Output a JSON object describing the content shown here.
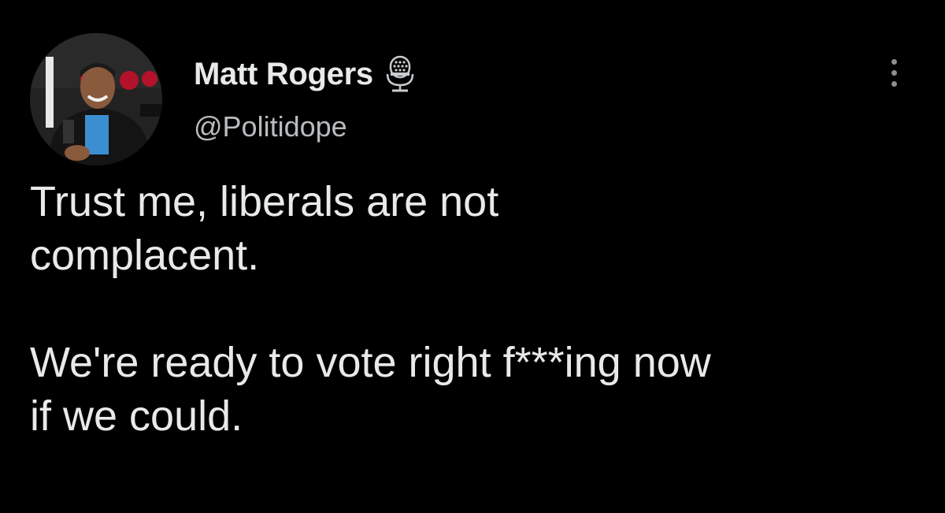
{
  "tweet": {
    "author": {
      "display_name": "Matt Rogers",
      "handle": "@Politidope",
      "avatar_icon": "profile-photo",
      "badge_icon": "microphone-icon"
    },
    "menu_icon": "more-options-icon",
    "body": {
      "line_1": "Trust me, liberals are not",
      "line_2": "complacent.",
      "line_3": "We're ready to vote right f***ing now",
      "line_4": "if we could."
    }
  },
  "colors": {
    "background": "#000000",
    "text_primary": "#e7e9ea",
    "text_secondary": "#b9bcbf",
    "icon_muted": "#8b8f94"
  }
}
